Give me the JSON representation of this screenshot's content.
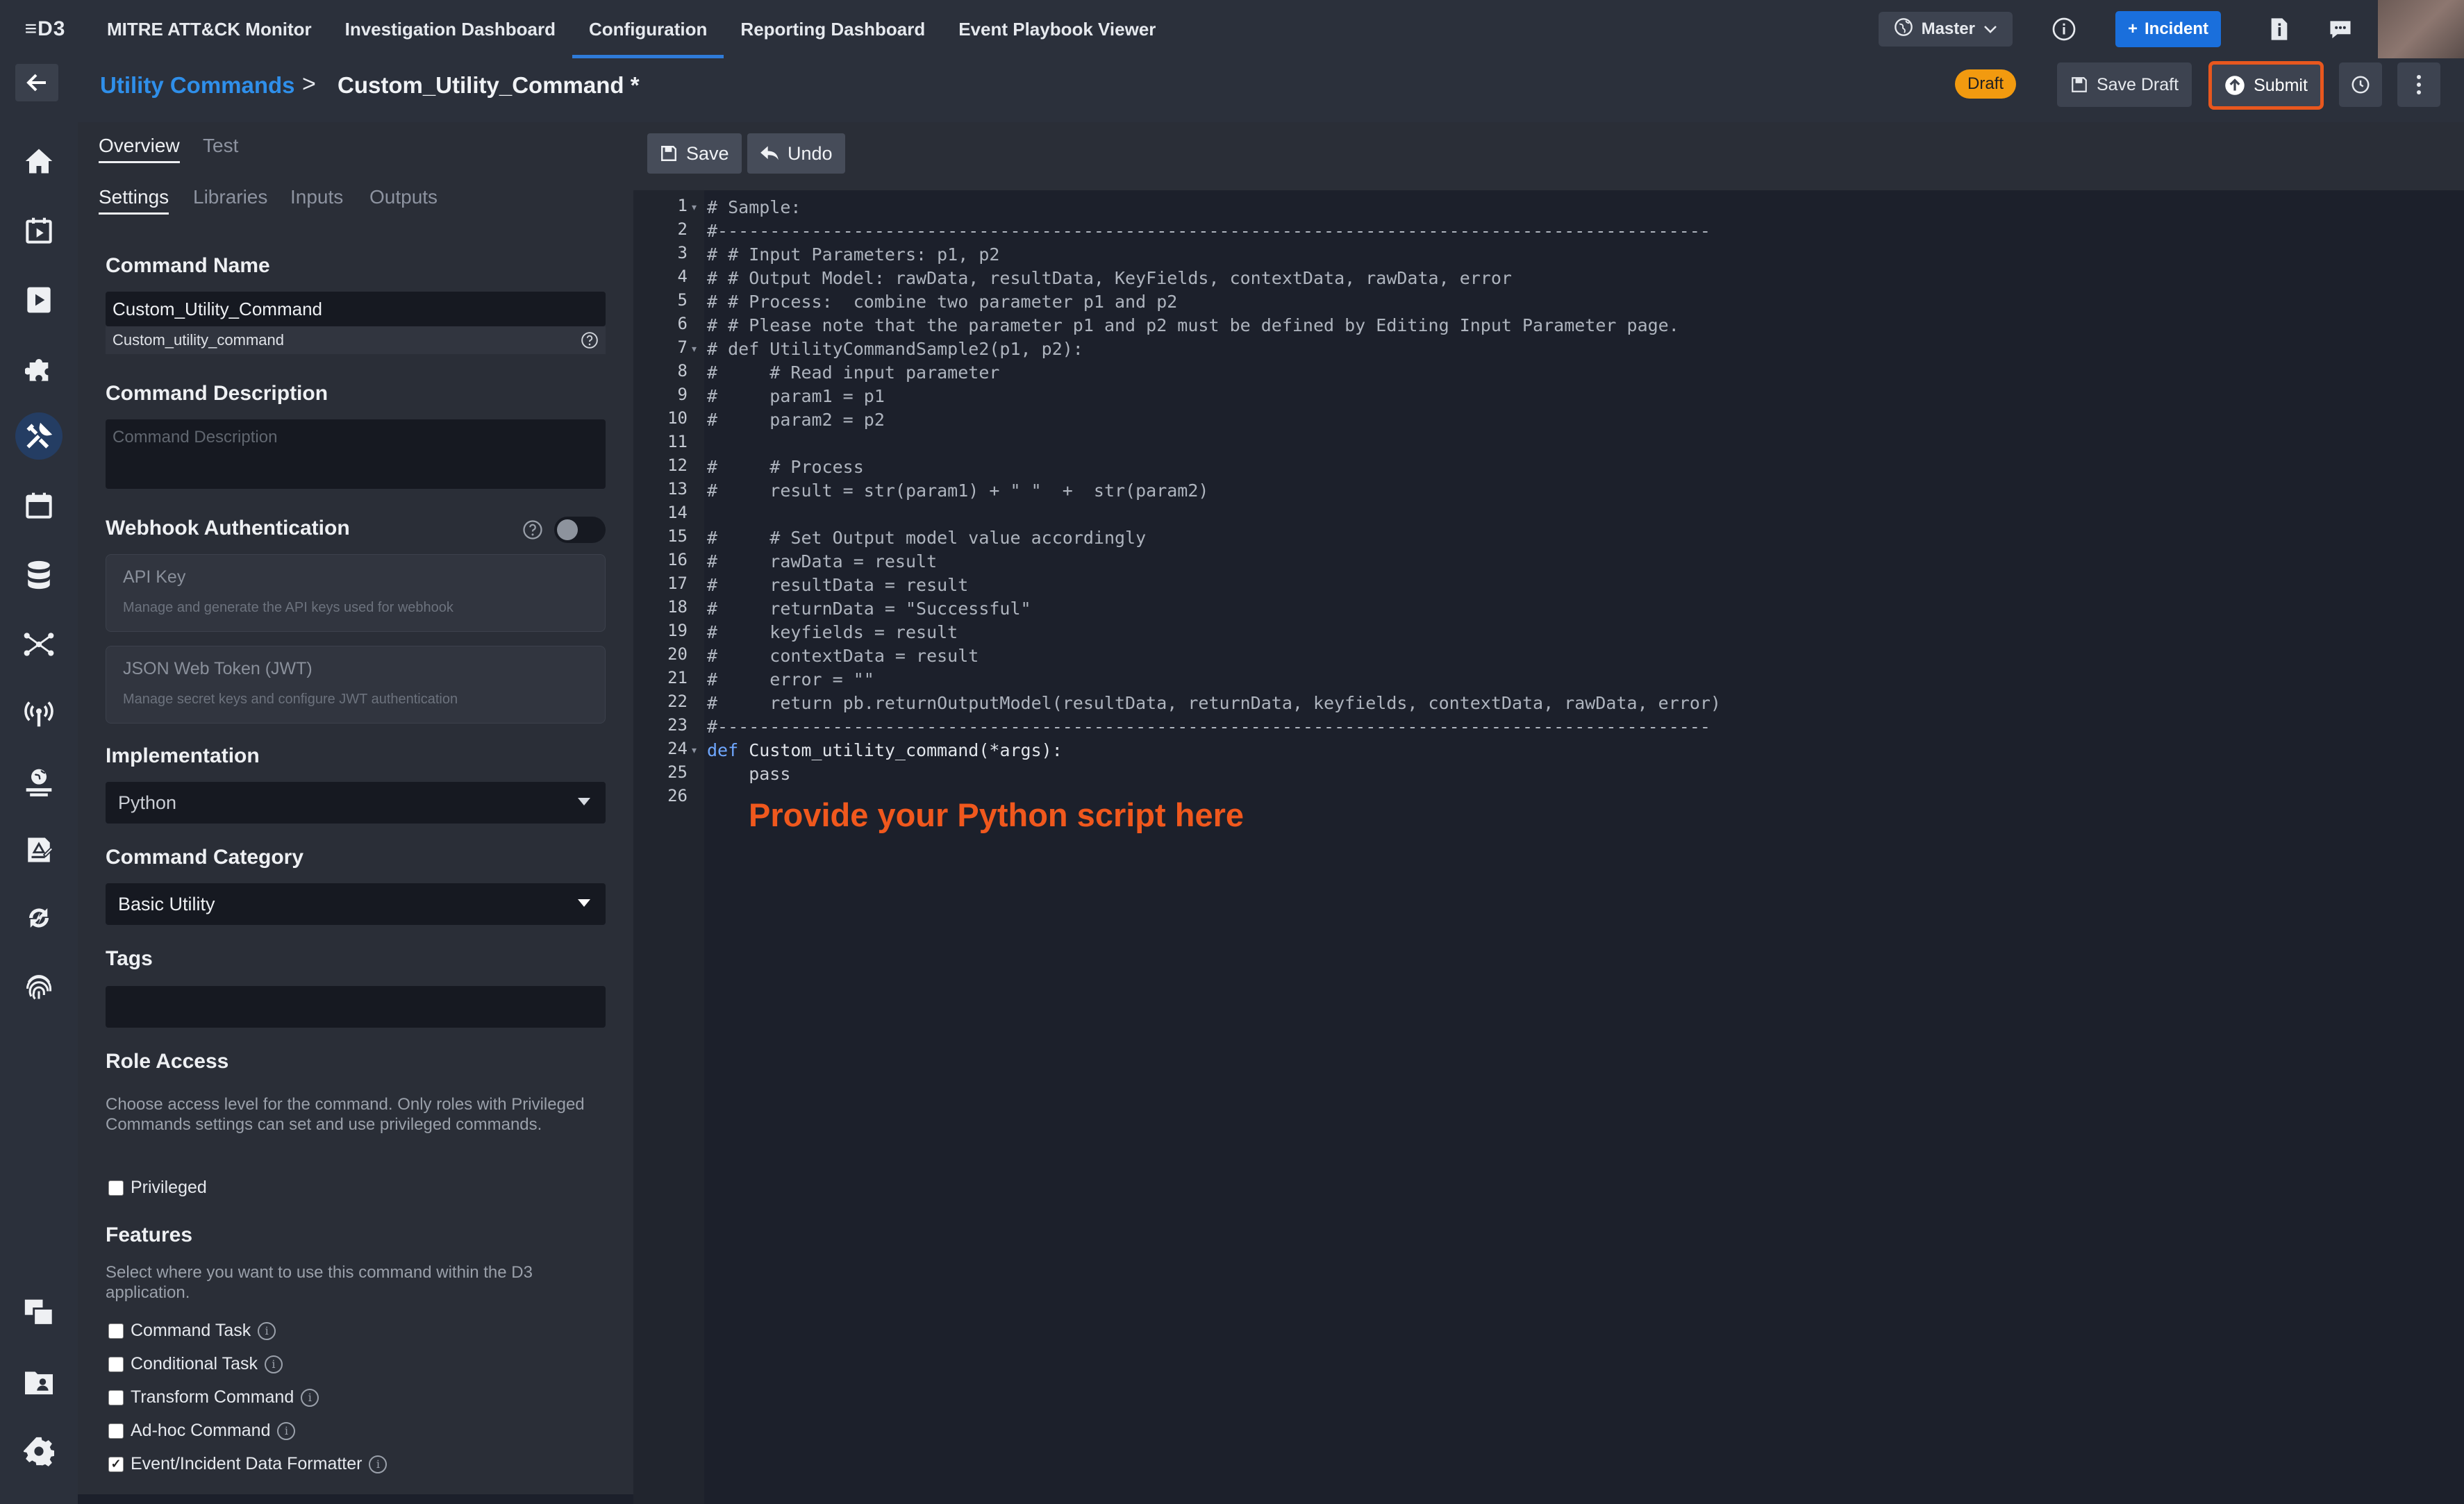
{
  "topnav": {
    "logo": "≡D3",
    "tabs": [
      "MITRE ATT&CK Monitor",
      "Investigation Dashboard",
      "Configuration",
      "Reporting Dashboard",
      "Event Playbook Viewer"
    ],
    "active_tab": "Configuration",
    "master_label": "Master",
    "incident_label": "Incident"
  },
  "breadcrumb": {
    "parent": "Utility Commands",
    "separator": ">",
    "current": "Custom_Utility_Command *"
  },
  "actions": {
    "draft_badge": "Draft",
    "save_draft": "Save Draft",
    "submit": "Submit"
  },
  "panel": {
    "tabs": [
      "Overview",
      "Test"
    ],
    "subtabs": [
      "Settings",
      "Libraries",
      "Inputs",
      "Outputs"
    ],
    "command_name": {
      "label": "Command Name",
      "value": "Custom_Utility_Command",
      "internal_name": "Custom_utility_command"
    },
    "command_description": {
      "label": "Command Description",
      "placeholder": "Command Description"
    },
    "webhook": {
      "label": "Webhook Authentication",
      "enabled": false,
      "cards": [
        {
          "title": "API Key",
          "subtitle": "Manage and generate the API keys used for webhook"
        },
        {
          "title": "JSON Web Token (JWT)",
          "subtitle": "Manage secret keys and configure JWT authentication"
        }
      ]
    },
    "implementation": {
      "label": "Implementation",
      "value": "Python"
    },
    "category": {
      "label": "Command Category",
      "value": "Basic Utility"
    },
    "tags": {
      "label": "Tags",
      "value": ""
    },
    "role_access": {
      "label": "Role Access",
      "help": "Choose access level for the command. Only roles with Privileged Commands settings can set and use privileged commands.",
      "privileged_label": "Privileged",
      "privileged_checked": false
    },
    "features": {
      "label": "Features",
      "help": "Select where you want to use this command within the D3 application.",
      "items": [
        {
          "label": "Command Task",
          "checked": false
        },
        {
          "label": "Conditional Task",
          "checked": false
        },
        {
          "label": "Transform Command",
          "checked": false
        },
        {
          "label": "Ad-hoc Command",
          "checked": false
        },
        {
          "label": "Event/Incident Data Formatter",
          "checked": true
        }
      ]
    }
  },
  "editor": {
    "save_label": "Save",
    "undo_label": "Undo",
    "active_line": 24,
    "lines": [
      "# Sample:",
      "#-----------------------------------------------------------------------------------------------",
      "# # Input Parameters: p1, p2",
      "# # Output Model: rawData, resultData, KeyFields, contextData, rawData, error",
      "# # Process:  combine two parameter p1 and p2",
      "# # Please note that the parameter p1 and p2 must be defined by Editing Input Parameter page.",
      "# def UtilityCommandSample2(p1, p2):",
      "#     # Read input parameter",
      "#     param1 = p1",
      "#     param2 = p2",
      "",
      "#     # Process",
      "#     result = str(param1) + \" \"  +  str(param2)",
      "",
      "#     # Set Output model value accordingly",
      "#     rawData = result",
      "#     resultData = result",
      "#     returnData = \"Successful\"",
      "#     keyfields = result",
      "#     contextData = result",
      "#     error = \"\"",
      "#     return pb.returnOutputModel(resultData, returnData, keyfields, contextData, rawData, error)",
      "#-----------------------------------------------------------------------------------------------",
      "def Custom_utility_command(*args):",
      "    pass",
      ""
    ],
    "fold_lines": [
      1,
      7,
      24
    ],
    "hint": "Provide your Python script here"
  },
  "icons": {
    "rail": [
      "home-icon",
      "calendar-play-icon",
      "play-icon",
      "puzzle-icon",
      "tools-icon",
      "calendar-icon",
      "database-icon",
      "network-icon",
      "antenna-icon",
      "user-globe-icon",
      "report-icon",
      "sync-icon",
      "fingerprint-icon",
      "copy-icon",
      "folder-user-icon",
      "gear-icon"
    ]
  },
  "colors": {
    "accent": "#2f8fea",
    "incident": "#1a6fdc",
    "draft": "#f29a0f",
    "submit_border": "#e8571e",
    "hint": "#f0581d"
  }
}
